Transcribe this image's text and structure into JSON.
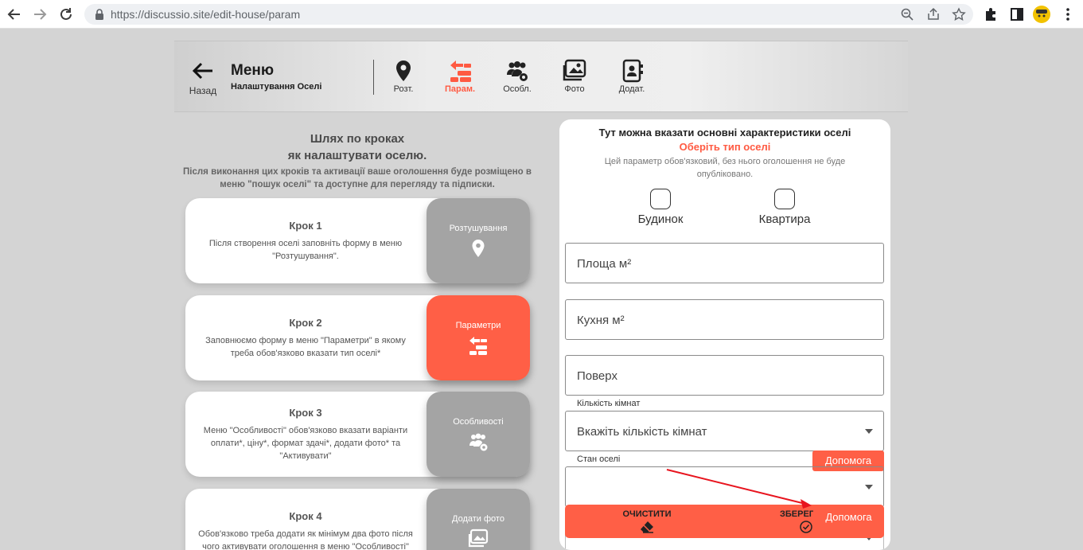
{
  "browser": {
    "url_host": "https://discussio.site",
    "url_path": "/edit-house/param"
  },
  "topnav": {
    "back_label": "Назад",
    "title": "Меню",
    "subtitle": "Налаштування Оселі",
    "items": [
      {
        "label": "Розт.",
        "icon": "location-pin-icon"
      },
      {
        "label": "Парам.",
        "icon": "params-icon"
      },
      {
        "label": "Особл.",
        "icon": "users-gear-icon"
      },
      {
        "label": "Фото",
        "icon": "photos-icon"
      },
      {
        "label": "Додат.",
        "icon": "contact-book-icon"
      }
    ]
  },
  "steps": {
    "heading1": "Шлях по кроках",
    "heading2": "як налаштувати оселю.",
    "intro": "Після виконання цих кроків та активації ваше оголошення буде розміщено в меню \"пошук оселі\" та доступне для перегляду та підписки.",
    "items": [
      {
        "title": "Крок 1",
        "desc": "Після створення оселі заповніть форму в меню \"Розтушування\".",
        "tile": "Розтушування"
      },
      {
        "title": "Крок 2",
        "desc": "Заповнюємо форму в меню \"Параметри\" в якому треба обов'язково вказати тип оселі*",
        "tile": "Параметри"
      },
      {
        "title": "Крок 3",
        "desc": "Меню \"Особливості\" обов'язково вказати варіанти оплати*, ціну*, формат здачі*, додати фото* та \"Активувати\"",
        "tile": "Особливості"
      },
      {
        "title": "Крок 4",
        "desc": "Обов'язково треба додати як мінімум два фото після чого активувати оголошення в меню \"Особливості\"",
        "tile": "Додати фото"
      }
    ]
  },
  "form": {
    "heading": "Тут можна вказати основні характеристики оселі",
    "subheading": "Оберіть тип оселі",
    "note": "Цей параметр обов'язковий, без нього оголошення не буде опубліковано.",
    "type_house": "Будинок",
    "type_flat": "Квартира",
    "area_placeholder": "Площа м²",
    "kitchen_placeholder": "Кухня м²",
    "floor_placeholder": "Поверх",
    "rooms_label": "Кількість кімнат",
    "rooms_value": "Вкажіть кількість кімнат",
    "condition_label": "Стан оселі",
    "condition_value": "",
    "help_label": "Допомога",
    "help_label_2": "Допомога",
    "clear_label": "ОЧИСТИТИ",
    "save_label": "ЗБЕРЕГТИ"
  },
  "colors": {
    "accent": "#ff5f46",
    "tile_gray": "#a4a4a4",
    "annotation_arrow": "#e8141e"
  }
}
